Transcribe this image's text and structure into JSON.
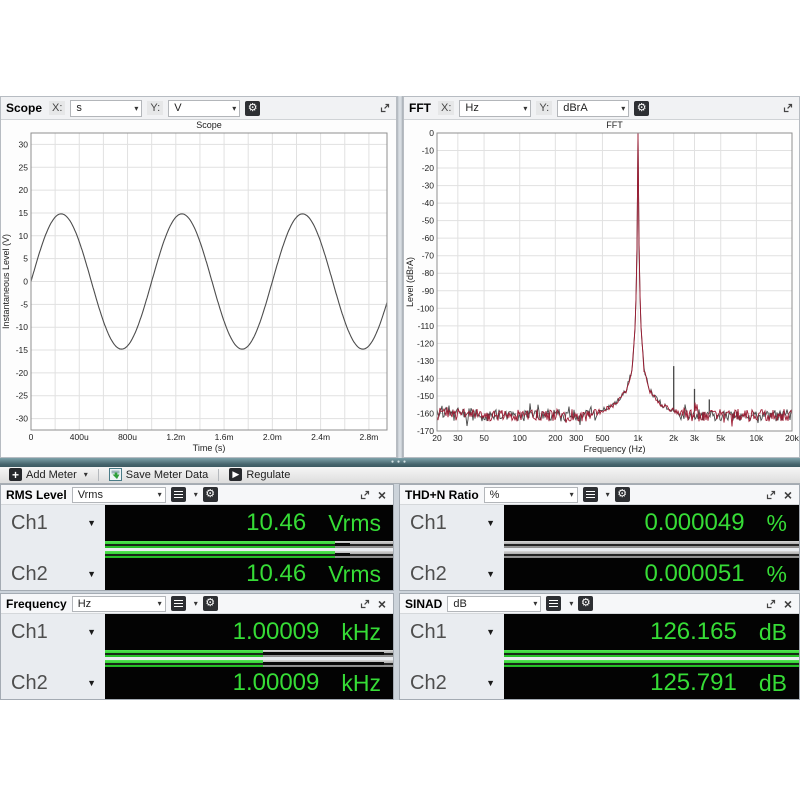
{
  "icons": {
    "dropdown_arrow": "▾",
    "channel_arrow": "▼",
    "gear": "⚙",
    "close": "×",
    "add": "+",
    "play": "▶",
    "splitter_dots": "●●●"
  },
  "scope_panel": {
    "title": "Scope",
    "x_axis_label": "X:",
    "x_unit": "s",
    "y_axis_label": "Y:",
    "y_unit": "V"
  },
  "fft_panel": {
    "title": "FFT",
    "x_axis_label": "X:",
    "x_unit": "Hz",
    "y_axis_label": "Y:",
    "y_unit": "dBrA"
  },
  "toolbar": {
    "add_meter_label": "Add Meter",
    "save_label": "Save Meter Data",
    "regulate_label": "Regulate"
  },
  "colors": {
    "meter_green": "#36dc36",
    "display_bg": "#030303",
    "scope_trace": "#4d4d4d",
    "fft_trace_ch1": "#9e1b32",
    "fft_trace_ch2": "#474747",
    "splitter_teal": "#46656d"
  },
  "meters": [
    {
      "title": "RMS Level",
      "unit_selected": "Vrms",
      "channels": [
        {
          "label": "Ch1",
          "value": "10.46",
          "unit": "Vrms",
          "bar_pct": 80,
          "peak_pct": 85
        },
        {
          "label": "Ch2",
          "value": "10.46",
          "unit": "Vrms",
          "bar_pct": 80,
          "peak_pct": 85
        }
      ]
    },
    {
      "title": "THD+N Ratio",
      "unit_selected": "%",
      "channels": [
        {
          "label": "Ch1",
          "value": "0.000049",
          "unit": "%",
          "bar_pct": 0,
          "peak_pct": 0
        },
        {
          "label": "Ch2",
          "value": "0.000051",
          "unit": "%",
          "bar_pct": 0,
          "peak_pct": 0
        }
      ]
    },
    {
      "title": "Frequency",
      "unit_selected": "Hz",
      "channels": [
        {
          "label": "Ch1",
          "value": "1.00009",
          "unit": "kHz",
          "bar_pct": 55,
          "peak_pct": 97
        },
        {
          "label": "Ch2",
          "value": "1.00009",
          "unit": "kHz",
          "bar_pct": 55,
          "peak_pct": 97
        }
      ]
    },
    {
      "title": "SINAD",
      "unit_selected": "dB",
      "channels": [
        {
          "label": "Ch1",
          "value": "126.165",
          "unit": "dB",
          "bar_pct": 100,
          "peak_pct": 100
        },
        {
          "label": "Ch2",
          "value": "125.791",
          "unit": "dB",
          "bar_pct": 100,
          "peak_pct": 100
        }
      ]
    }
  ],
  "chart_data": [
    {
      "type": "line",
      "title": "Scope",
      "xlabel": "Time (s)",
      "ylabel": "Instantaneous Level (V)",
      "xscale": "linear",
      "xlim": [
        0,
        0.00295
      ],
      "ylim": [
        -32.5,
        32.5
      ],
      "x_ticks": [
        {
          "v": 0,
          "label": "0"
        },
        {
          "v": 0.0004,
          "label": "400u"
        },
        {
          "v": 0.0008,
          "label": "800u"
        },
        {
          "v": 0.0012,
          "label": "1.2m"
        },
        {
          "v": 0.0016,
          "label": "1.6m"
        },
        {
          "v": 0.002,
          "label": "2.0m"
        },
        {
          "v": 0.0024,
          "label": "2.4m"
        },
        {
          "v": 0.0028,
          "label": "2.8m"
        }
      ],
      "x_grid_step": 0.0002,
      "y_tick_min": -30,
      "y_tick_max": 30,
      "y_tick_step": 5,
      "grid": true,
      "signal": {
        "waveform": "sine",
        "amplitude_v": 14.8,
        "frequency_hz": 1000,
        "phase_deg": 0
      },
      "trace_color": "#4d4d4d"
    },
    {
      "type": "line",
      "title": "FFT",
      "xlabel": "Frequency (Hz)",
      "ylabel": "Level (dBrA)",
      "xscale": "log",
      "xlim": [
        20,
        20000
      ],
      "ylim": [
        -170,
        0
      ],
      "x_ticks": [
        {
          "v": 20,
          "label": "20"
        },
        {
          "v": 30,
          "label": "30"
        },
        {
          "v": 50,
          "label": "50"
        },
        {
          "v": 100,
          "label": "100"
        },
        {
          "v": 200,
          "label": "200"
        },
        {
          "v": 300,
          "label": "300"
        },
        {
          "v": 500,
          "label": "500"
        },
        {
          "v": 1000,
          "label": "1k"
        },
        {
          "v": 2000,
          "label": "2k"
        },
        {
          "v": 3000,
          "label": "3k"
        },
        {
          "v": 5000,
          "label": "5k"
        },
        {
          "v": 10000,
          "label": "10k"
        },
        {
          "v": 20000,
          "label": "20k"
        }
      ],
      "y_tick_step": 10,
      "grid": true,
      "fundamental": {
        "frequency_hz": 1000,
        "level_db": 0
      },
      "noise_floor_db": -161,
      "noise_jitter_db": 3.5,
      "skirt_profile": [
        [
          0,
          0
        ],
        [
          0.008,
          -62
        ],
        [
          0.02,
          -105
        ],
        [
          0.05,
          -135
        ],
        [
          0.1,
          -147
        ],
        [
          0.2,
          -155
        ],
        [
          0.35,
          -160
        ]
      ],
      "spurs": [
        {
          "frequency_hz": 2000,
          "level_db": -133
        },
        {
          "frequency_hz": 3000,
          "level_db": -146
        },
        {
          "frequency_hz": 4000,
          "level_db": -152
        }
      ],
      "series": [
        {
          "name": "Ch1",
          "color": "#9e1b32"
        },
        {
          "name": "Ch2",
          "color": "#474747"
        }
      ]
    }
  ]
}
